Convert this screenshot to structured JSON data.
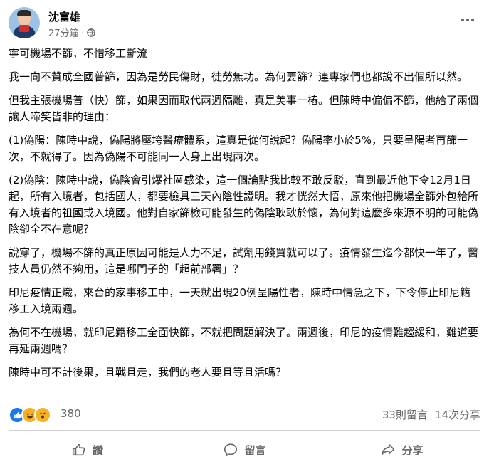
{
  "post": {
    "author": "沈富雄",
    "time": "27分鐘",
    "separator": "·",
    "privacy_icon": "globe-icon",
    "paragraphs": [
      "寧可機場不篩，不惜移工斷流",
      "我一向不贊成全國普篩，因為是勞民傷財，徒勞無功。為何要篩？連專家們也都說不出個所以然。",
      "但我主張機場普（快）篩，如果因而取代兩週隔離，真是美事一樁。但陳時中偏偏不篩，他給了兩個讓人啼笑皆非的理由：",
      "(1)偽陽：陳時中說，偽陽將壓垮醫療體系，這真是從何說起？偽陽率小於5%，只要呈陽者再篩一次，不就得了。因為偽陽不可能同一人身上出現兩次。",
      "(2)偽陰：陳時中說，偽陰會引爆社區感染，這一個論點我比較不敢反駁，直到最近他下令12月1日起，所有入境者，包括國人，都要檢具三天內陰性證明。我才恍然大悟，原來他把機場全篩外包給所有入境者的祖國或入境國。他對自家篩檢可能發生的偽陰耿耿於懷，為何對這麼多來源不明的可能偽陰卻全不在意呢？",
      "說穿了，機場不篩的真正原因可能是人力不足，試劑用錢買就可以了。疫情發生迄今都快一年了，醫技人員仍然不夠用，這是哪門子的「超前部署」？",
      "印尼疫情正熾，來台的家事移工中，一天就出現20例呈陽性者，陳時中情急之下，下令停止印尼籍移工入境兩週。",
      "為何不在機場，就印尼籍移工全面快篩，不就把問題解決了。兩週後，印尼的疫情難趨緩和，難道要再延兩週嗎？",
      "陳時中可不計後果，且戰且走，我們的老人要且等且活嗎？"
    ]
  },
  "reactions": {
    "icons": [
      "like-icon",
      "haha-icon",
      "wow-icon"
    ],
    "count": "380",
    "comments": "33則留言",
    "shares": "14次分享"
  },
  "actions": {
    "like": "讚",
    "comment": "留言",
    "share": "分享"
  },
  "colors": {
    "like_blue": "#1877f2",
    "emoji_yellow": "#f7b125",
    "secondary_text": "#65676b"
  }
}
